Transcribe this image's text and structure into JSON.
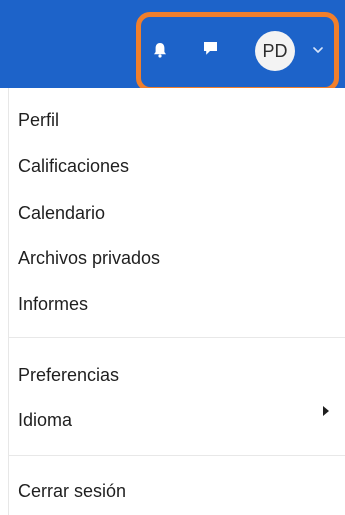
{
  "header": {
    "avatar_initials": "PD",
    "icons": {
      "notifications": "bell-icon",
      "messages": "chat-icon",
      "dropdown": "chevron-down-icon"
    },
    "colors": {
      "navbar": "#1d63c9",
      "highlight": "#f07f2c",
      "avatar_bg": "#f3f3f3"
    }
  },
  "menu": {
    "items": [
      {
        "label": "Perfil"
      },
      {
        "label": "Calificaciones"
      },
      {
        "label": "Calendario"
      },
      {
        "label": "Archivos privados"
      },
      {
        "label": "Informes"
      },
      {
        "label": "Preferencias"
      },
      {
        "label": "Idioma"
      },
      {
        "label": "Cerrar sesión"
      }
    ],
    "submenu_icon": "caret-right-icon"
  }
}
